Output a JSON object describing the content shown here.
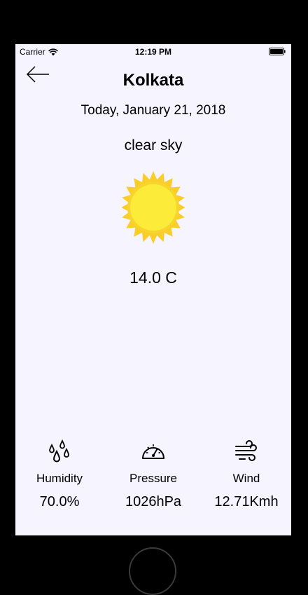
{
  "status_bar": {
    "carrier": "Carrier",
    "time": "12:19 PM"
  },
  "header": {
    "city": "Kolkata",
    "date": "Today, January 21, 2018"
  },
  "weather": {
    "condition": "clear sky",
    "icon": "sun-icon",
    "temperature": "14.0 C"
  },
  "stats": [
    {
      "label": "Humidity",
      "value": "70.0%",
      "icon": "humidity-drops-icon"
    },
    {
      "label": "Pressure",
      "value": "1026hPa",
      "icon": "pressure-gauge-icon"
    },
    {
      "label": "Wind",
      "value": "12.71Kmh",
      "icon": "wind-icon"
    }
  ],
  "colors": {
    "background": "#f5f4ff",
    "sun_outer": "#f9cd2a",
    "sun_inner": "#fdeb3a"
  }
}
